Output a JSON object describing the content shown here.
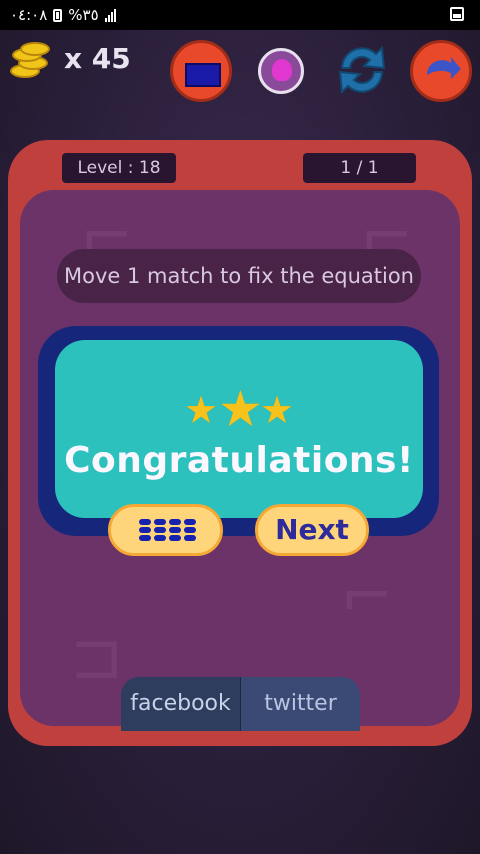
{
  "status_bar": {
    "time": "٠٤:٠٨",
    "battery": "%٣٥"
  },
  "hud": {
    "coin_count": "x 45",
    "icons": [
      "coin-stack-icon",
      "level-grid-icon",
      "lightbulb-hint-icon",
      "refresh-icon",
      "share-icon"
    ]
  },
  "board": {
    "level_label": "Level : 18",
    "progress": "1 / 1",
    "instruction": "Move 1 match to fix the equation"
  },
  "modal": {
    "stars_earned": 3,
    "title": "Congratulations!",
    "next_label": "Next"
  },
  "social": {
    "facebook_label": "facebook",
    "twitter_label": "twitter"
  },
  "colors": {
    "board_red": "#c0403e",
    "board_purple": "#6c3368",
    "modal_teal": "#2cc1bd",
    "modal_frame": "#16267a",
    "pill_yellow": "#fed57b",
    "next_text": "#2d2a9b"
  }
}
